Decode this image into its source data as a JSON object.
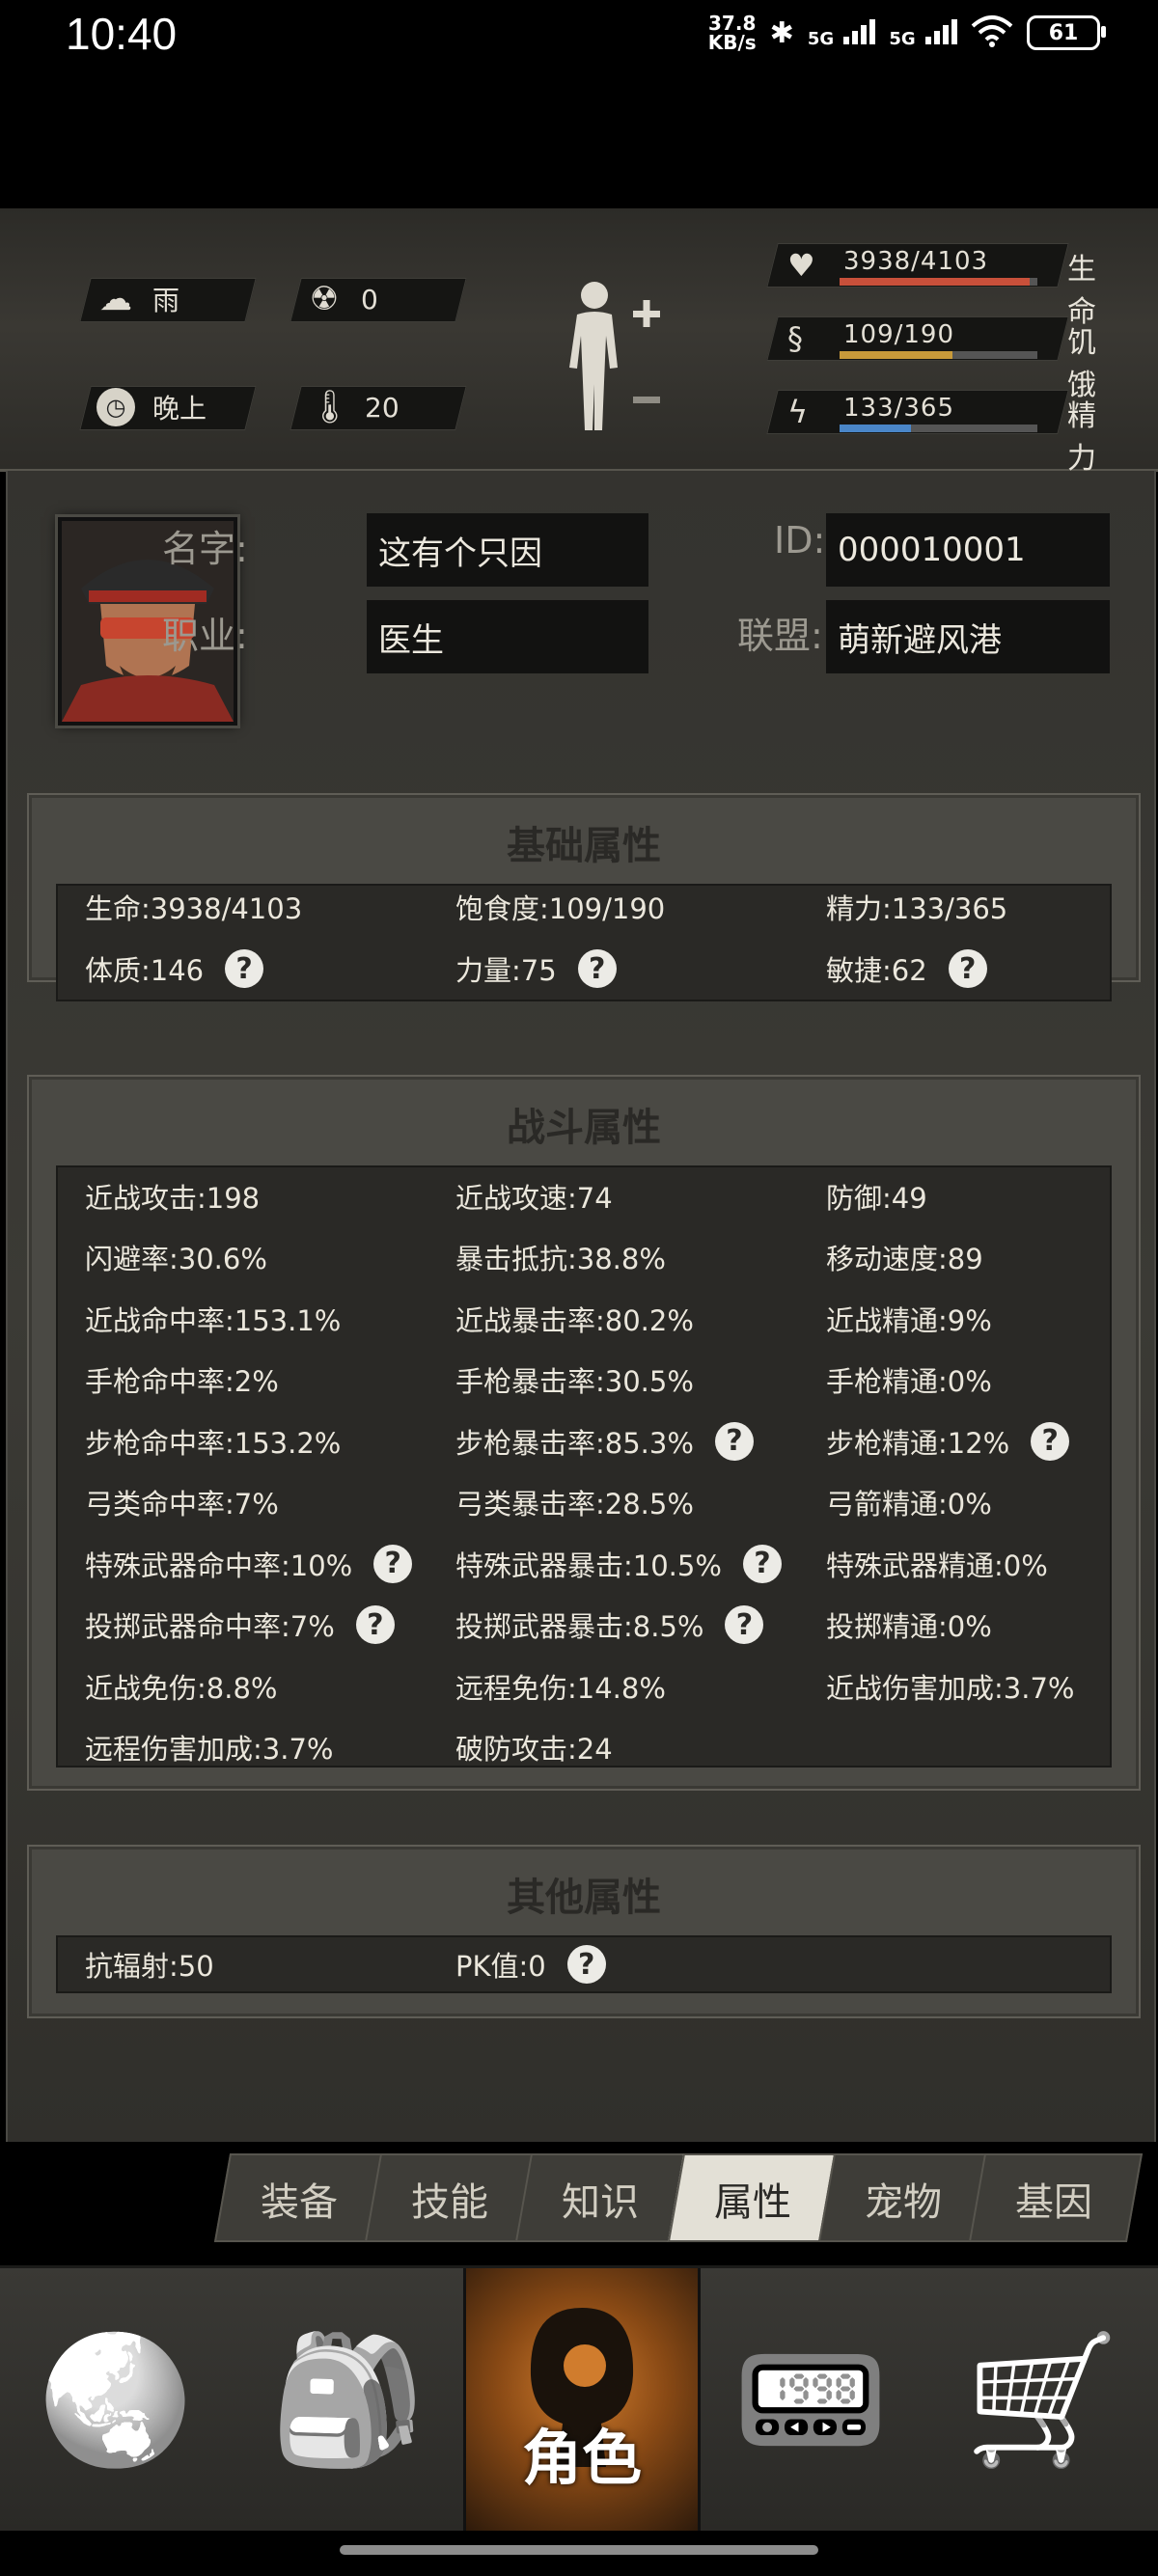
{
  "status_bar": {
    "time": "10:40",
    "speed_value": "37.8",
    "speed_unit": "KB/s",
    "net1": "5G",
    "net2": "5G",
    "battery": "61",
    "icons": [
      "bluetooth-icon",
      "signal-icon",
      "wifi-icon",
      "battery-icon"
    ]
  },
  "hud": {
    "weather": "雨",
    "radiation": "0",
    "time_of_day": "晚上",
    "temperature": "20",
    "stats": [
      {
        "label": "生命",
        "text": "3938/4103",
        "fraction": 0.96,
        "color": "#c8503a",
        "icon": "heart-icon"
      },
      {
        "label": "饥饿",
        "text": "109/190",
        "fraction": 0.57,
        "color": "#c89a3a",
        "icon": "stomach-icon"
      },
      {
        "label": "精力",
        "text": "133/365",
        "fraction": 0.36,
        "color": "#4a86c8",
        "icon": "energy-icon"
      }
    ]
  },
  "profile": {
    "name_label": "名字:",
    "name": "这有个只因",
    "job_label": "职业:",
    "job": "医生",
    "id_label": "ID:",
    "id": "000010001",
    "alliance_label": "联盟:",
    "alliance": "萌新避风港"
  },
  "basic": {
    "title": "基础属性",
    "rows": [
      [
        {
          "text": "生命:3938/4103",
          "help": false
        },
        {
          "text": "饱食度:109/190",
          "help": false
        },
        {
          "text": "精力:133/365",
          "help": false
        }
      ],
      [
        {
          "text": "体质:146",
          "help": true
        },
        {
          "text": "力量:75",
          "help": true
        },
        {
          "text": "敏捷:62",
          "help": true
        }
      ]
    ]
  },
  "combat": {
    "title": "战斗属性",
    "rows": [
      [
        {
          "text": "近战攻击:198",
          "help": false
        },
        {
          "text": "近战攻速:74",
          "help": false
        },
        {
          "text": "防御:49",
          "help": false
        }
      ],
      [
        {
          "text": "闪避率:30.6%",
          "help": false
        },
        {
          "text": "暴击抵抗:38.8%",
          "help": false
        },
        {
          "text": "移动速度:89",
          "help": false
        }
      ],
      [
        {
          "text": "近战命中率:153.1%",
          "help": false
        },
        {
          "text": "近战暴击率:80.2%",
          "help": false
        },
        {
          "text": "近战精通:9%",
          "help": false
        }
      ],
      [
        {
          "text": "手枪命中率:2%",
          "help": false
        },
        {
          "text": "手枪暴击率:30.5%",
          "help": false
        },
        {
          "text": "手枪精通:0%",
          "help": false
        }
      ],
      [
        {
          "text": "步枪命中率:153.2%",
          "help": false
        },
        {
          "text": "步枪暴击率:85.3%",
          "help": true
        },
        {
          "text": "步枪精通:12%",
          "help": true
        }
      ],
      [
        {
          "text": "弓类命中率:7%",
          "help": false
        },
        {
          "text": "弓类暴击率:28.5%",
          "help": false
        },
        {
          "text": "弓箭精通:0%",
          "help": false
        }
      ],
      [
        {
          "text": "特殊武器命中率:10%",
          "help": true
        },
        {
          "text": "特殊武器暴击:10.5%",
          "help": true
        },
        {
          "text": "特殊武器精通:0%",
          "help": false
        }
      ],
      [
        {
          "text": "投掷武器命中率:7%",
          "help": true
        },
        {
          "text": "投掷武器暴击:8.5%",
          "help": true
        },
        {
          "text": "投掷精通:0%",
          "help": false
        }
      ],
      [
        {
          "text": "近战免伤:8.8%",
          "help": false
        },
        {
          "text": "远程免伤:14.8%",
          "help": false
        },
        {
          "text": "近战伤害加成:3.7%",
          "help": false
        }
      ],
      [
        {
          "text": "远程伤害加成:3.7%",
          "help": false
        },
        {
          "text": "破防攻击:24",
          "help": false
        },
        null
      ]
    ]
  },
  "other": {
    "title": "其他属性",
    "rows": [
      [
        {
          "text": "抗辐射:50",
          "help": false
        },
        {
          "text": "PK值:0",
          "help": true
        },
        null
      ]
    ]
  },
  "help_glyph": "?",
  "tabs": [
    {
      "label": "装备",
      "active": false
    },
    {
      "label": "技能",
      "active": false
    },
    {
      "label": "知识",
      "active": false
    },
    {
      "label": "属性",
      "active": true
    },
    {
      "label": "宠物",
      "active": false
    },
    {
      "label": "基因",
      "active": false
    }
  ],
  "nav": [
    {
      "icon": "globe-icon",
      "label": "",
      "active": false
    },
    {
      "icon": "backpack-icon",
      "label": "",
      "active": false
    },
    {
      "icon": "character-icon",
      "label": "角色",
      "active": true
    },
    {
      "icon": "radio-icon",
      "label": "",
      "active": false
    },
    {
      "icon": "cart-icon",
      "label": "",
      "active": false
    }
  ]
}
